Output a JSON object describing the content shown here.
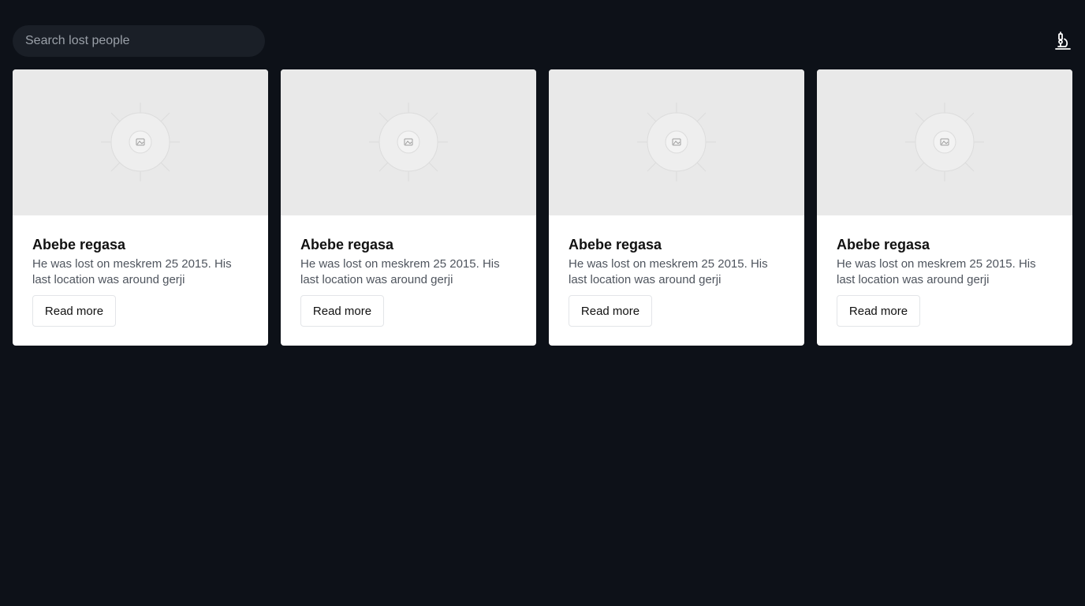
{
  "search": {
    "placeholder": "Search lost people",
    "value": ""
  },
  "header": {
    "action_icon": "microscope-icon"
  },
  "cards": [
    {
      "title": "Abebe regasa",
      "description": "He was lost on meskrem 25 2015. His last location was around gerji",
      "button_label": "Read more",
      "image_icon": "image-placeholder-icon"
    },
    {
      "title": "Abebe regasa",
      "description": "He was lost on meskrem 25 2015. His last location was around gerji",
      "button_label": "Read more",
      "image_icon": "image-placeholder-icon"
    },
    {
      "title": "Abebe regasa",
      "description": "He was lost on meskrem 25 2015. His last location was around gerji",
      "button_label": "Read more",
      "image_icon": "image-placeholder-icon"
    },
    {
      "title": "Abebe regasa",
      "description": "He was lost on meskrem 25 2015. His last location was around gerji",
      "button_label": "Read more",
      "image_icon": "image-placeholder-icon"
    }
  ],
  "colors": {
    "background": "#0d1118",
    "search_bg": "#1a1f27",
    "card_bg": "#ffffff",
    "image_placeholder_bg": "#e9e9e9"
  }
}
